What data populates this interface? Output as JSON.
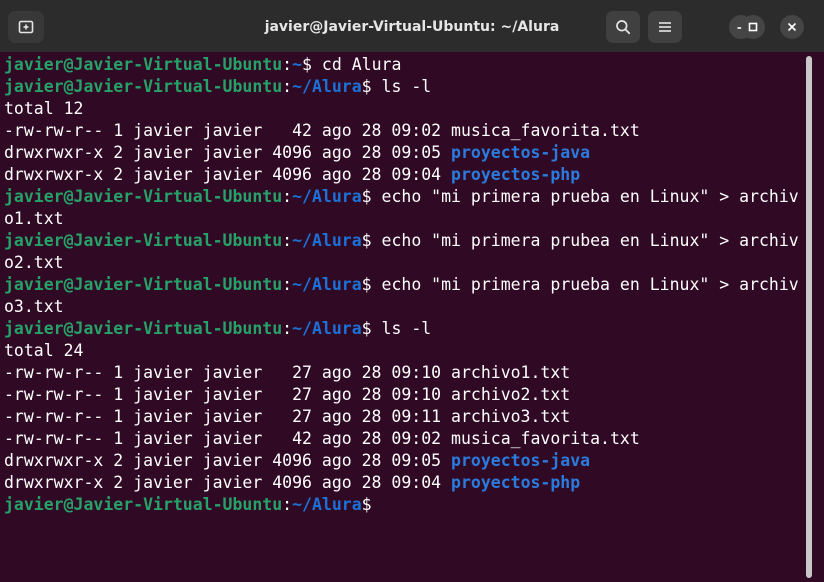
{
  "window": {
    "title": "javier@Javier-Virtual-Ubuntu: ~/Alura"
  },
  "icons": {
    "new_tab": "new-tab-icon",
    "search": "search-icon",
    "menu": "hamburger-menu-icon",
    "minimize": "minimize-icon",
    "maximize": "maximize-icon",
    "close": "close-icon"
  },
  "colors": {
    "background": "#300a24",
    "text": "#ffffff",
    "user_host": "#26a269",
    "path": "#1c71d8",
    "directory": "#2a7bde"
  },
  "prompt": {
    "user_host": "javier@Javier-Virtual-Ubuntu",
    "path_home": "~",
    "path_alura": "~/Alura"
  },
  "lines": [
    {
      "cmd": " cd Alura"
    },
    {
      "cmd": " ls -l"
    },
    {
      "text": "total 12"
    },
    {
      "text": "-rw-rw-r-- 1 javier javier   42 ago 28 09:02 musica_favorita.txt"
    },
    {
      "text": "drwxrwxr-x 2 javier javier 4096 ago 28 09:05 ",
      "dir": "proyectos-java"
    },
    {
      "text": "drwxrwxr-x 2 javier javier 4096 ago 28 09:04 ",
      "dir": "proyectos-php"
    },
    {
      "cmd": " echo \"mi primera prueba en Linux\" > archiv"
    },
    {
      "text": "o1.txt"
    },
    {
      "cmd": " echo \"mi primera prubea en Linux\" > archiv"
    },
    {
      "text": "o2.txt"
    },
    {
      "cmd": " echo \"mi primera prueba en Linux\" > archiv"
    },
    {
      "text": "o3.txt"
    },
    {
      "cmd": " ls -l"
    },
    {
      "text": "total 24"
    },
    {
      "text": "-rw-rw-r-- 1 javier javier   27 ago 28 09:10 archivo1.txt"
    },
    {
      "text": "-rw-rw-r-- 1 javier javier   27 ago 28 09:10 archivo2.txt"
    },
    {
      "text": "-rw-rw-r-- 1 javier javier   27 ago 28 09:11 archivo3.txt"
    },
    {
      "text": "-rw-rw-r-- 1 javier javier   42 ago 28 09:02 musica_favorita.txt"
    },
    {
      "text": "drwxrwxr-x 2 javier javier 4096 ago 28 09:05 ",
      "dir": "proyectos-java"
    },
    {
      "text": "drwxrwxr-x 2 javier javier 4096 ago 28 09:04 ",
      "dir": "proyectos-php"
    },
    {
      "cmd": ""
    }
  ]
}
